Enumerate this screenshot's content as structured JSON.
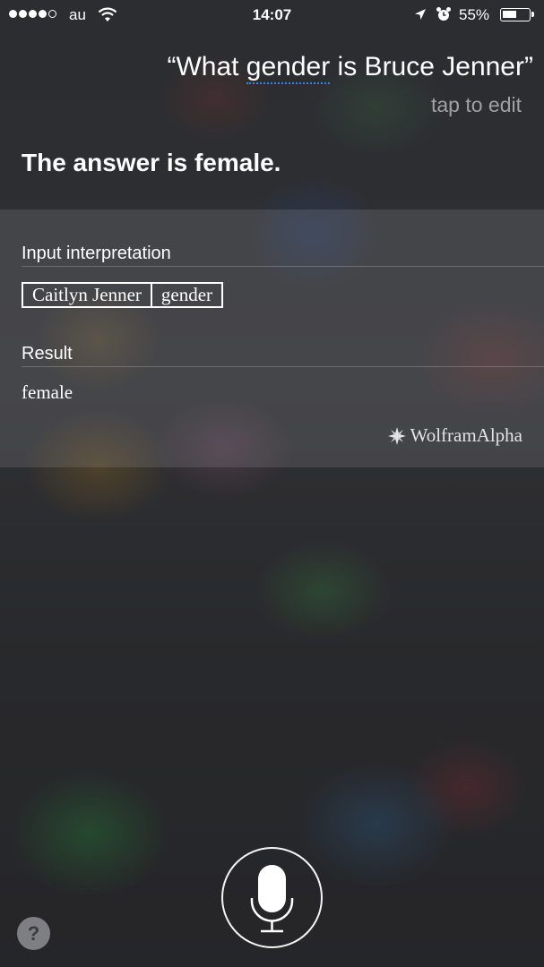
{
  "status_bar": {
    "carrier": "au",
    "time": "14:07",
    "battery_percent": "55%",
    "battery_level": 0.55,
    "signal_bars_filled": 4,
    "signal_bars_total": 5,
    "icons": [
      "wifi-icon",
      "location-arrow-icon",
      "alarm-clock-icon",
      "battery-icon"
    ]
  },
  "query": {
    "open_quote": "“",
    "before": "What ",
    "underlined": "gender",
    "after": " is Bruce Jenner",
    "close_quote": "”",
    "tap_to_edit": "tap to edit"
  },
  "answer": {
    "text": "The answer is female."
  },
  "wolfram_card": {
    "input_label": "Input interpretation",
    "interpretation": [
      "Caitlyn Jenner",
      "gender"
    ],
    "result_label": "Result",
    "result_value": "female",
    "brand": "WolframAlpha"
  },
  "controls": {
    "help_label": "?",
    "mic_icon": "microphone-icon"
  },
  "colors": {
    "underline_accent": "#2b87f5",
    "text": "#ffffff"
  }
}
